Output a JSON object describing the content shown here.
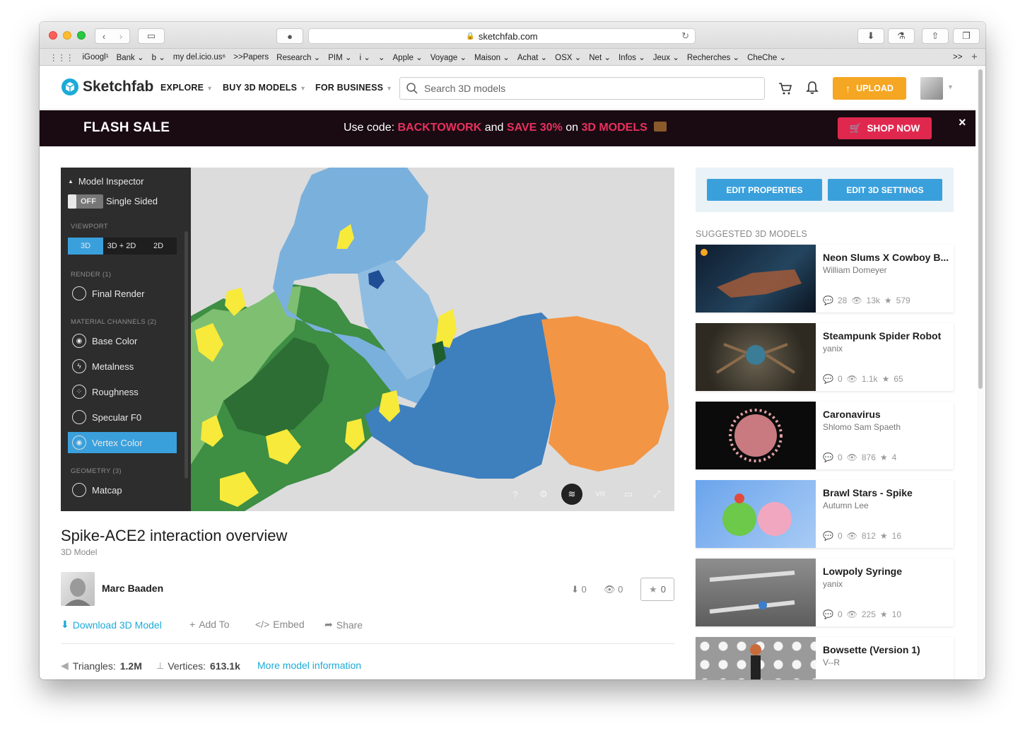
{
  "browser": {
    "url": "sketchfab.com",
    "bookmarks": [
      "iGoogl¹",
      "Bank ⌄",
      "b ⌄",
      "my del.icio.us⁶",
      ">>Papers",
      "Research ⌄",
      "PIM ⌄",
      "i ⌄",
      " ⌄",
      "Apple ⌄",
      "Voyage ⌄",
      "Maison ⌄",
      "Achat ⌄",
      "OSX ⌄",
      "Net ⌄",
      "Infos ⌄",
      "Jeux ⌄",
      "Recherches ⌄",
      "CheChe ⌄"
    ],
    "more": ">>"
  },
  "header": {
    "logo": "Sketchfab",
    "nav": [
      "EXPLORE",
      "BUY 3D MODELS",
      "FOR BUSINESS"
    ],
    "search_placeholder": "Search 3D models",
    "upload": "UPLOAD"
  },
  "flash": {
    "title": "FLASH SALE",
    "msg_prefix": "Use code: ",
    "code": "BACKTOWORK",
    "and": " and ",
    "save": "SAVE 30%",
    "on": " on ",
    "models": "3D MODELS",
    "button": "SHOP NOW",
    "close": "×"
  },
  "inspector": {
    "title": "Model Inspector",
    "toggle": "OFF",
    "single_sided": "Single Sided",
    "viewport_label": "VIEWPORT",
    "viewport": [
      "3D",
      "3D + 2D",
      "2D"
    ],
    "render_label": "RENDER (1)",
    "final_render": "Final Render",
    "material_label": "MATERIAL CHANNELS (2)",
    "channels": [
      "Base Color",
      "Metalness",
      "Roughness",
      "Specular F0",
      "Vertex Color"
    ],
    "geometry_label": "GEOMETRY (3)",
    "matcap": "Matcap"
  },
  "viewer_tools": [
    "?",
    "⚙",
    "≋",
    "VR",
    "▭",
    "⤢"
  ],
  "edit": {
    "properties": "EDIT PROPERTIES",
    "settings": "EDIT 3D SETTINGS"
  },
  "suggested": {
    "title": "SUGGESTED 3D MODELS",
    "items": [
      {
        "title": "Neon Slums X Cowboy B...",
        "author": "William Domeyer",
        "comments": "28",
        "views": "13k",
        "likes": "579"
      },
      {
        "title": "Steampunk Spider Robot",
        "author": "yanix",
        "comments": "0",
        "views": "1.1k",
        "likes": "65"
      },
      {
        "title": "Caronavirus",
        "author": "Shlomo Sam Spaeth",
        "comments": "0",
        "views": "876",
        "likes": "4"
      },
      {
        "title": "Brawl Stars - Spike",
        "author": "Autumn Lee",
        "comments": "0",
        "views": "812",
        "likes": "16"
      },
      {
        "title": "Lowpoly Syringe",
        "author": "yanix",
        "comments": "0",
        "views": "225",
        "likes": "10"
      },
      {
        "title": "Bowsette (Version 1)",
        "author": "V--R",
        "comments": "",
        "views": "",
        "likes": ""
      }
    ]
  },
  "model": {
    "title": "Spike-ACE2 interaction overview",
    "subtitle": "3D Model",
    "author": "Marc Baaden",
    "downloads": "0",
    "views": "0",
    "likes": "0",
    "actions": [
      "Download 3D Model",
      "Add To",
      "Embed",
      "Share"
    ],
    "triangles_label": "Triangles:",
    "triangles": "1.2M",
    "vertices_label": "Vertices:",
    "vertices": "613.1k",
    "more_info": "More model information"
  }
}
